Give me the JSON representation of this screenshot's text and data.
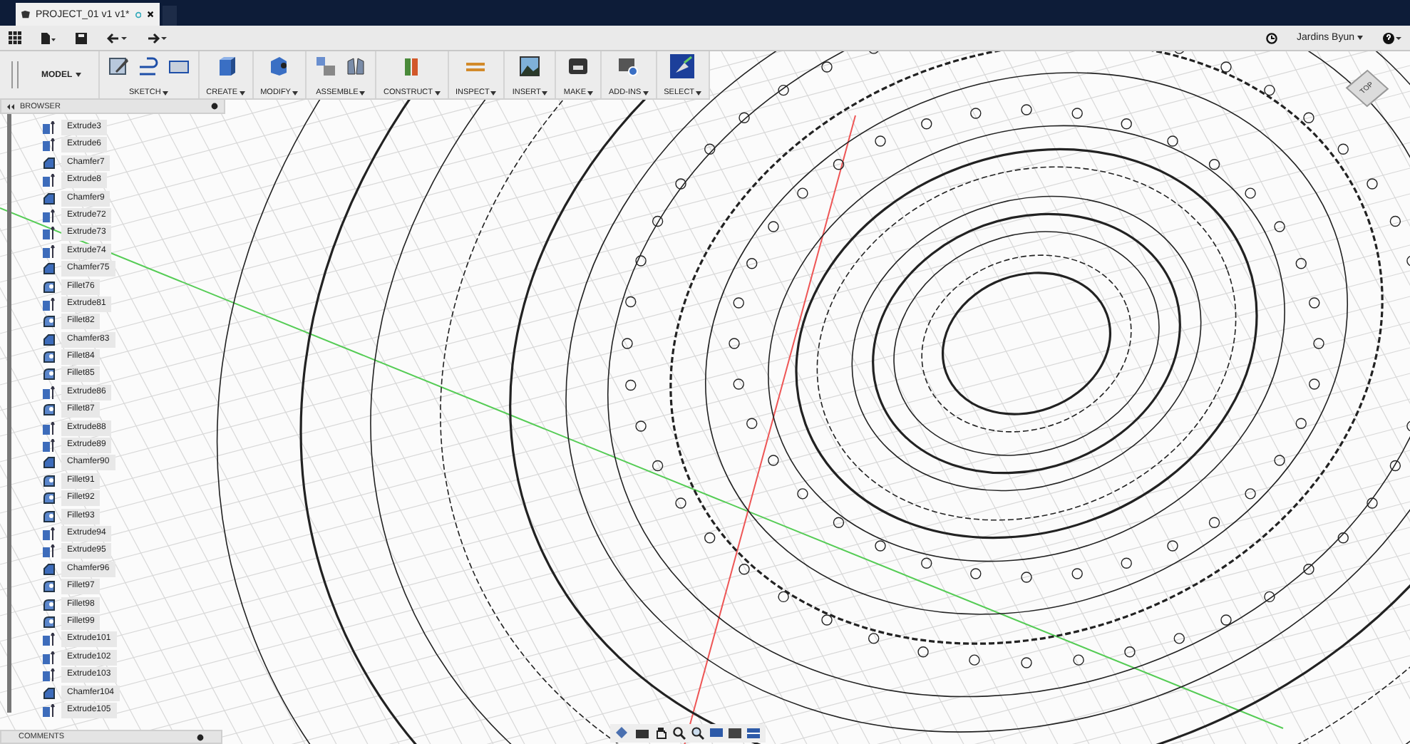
{
  "tab": {
    "title": "PROJECT_01 v1 v1*",
    "unsaved": true
  },
  "user": {
    "name": "Jardins Byun"
  },
  "toolbar": {
    "workspace": "MODEL",
    "groups": [
      {
        "label": "SKETCH",
        "selected": false,
        "tools": [
          {
            "kind": "sketch"
          },
          {
            "kind": "line"
          },
          {
            "kind": "rectangle"
          }
        ]
      },
      {
        "label": "CREATE",
        "selected": false,
        "tools": [
          {
            "kind": "extrude"
          }
        ]
      },
      {
        "label": "MODIFY",
        "selected": false,
        "tools": [
          {
            "kind": "press"
          }
        ]
      },
      {
        "label": "ASSEMBLE",
        "selected": false,
        "tools": [
          {
            "kind": "component"
          },
          {
            "kind": "joint"
          }
        ]
      },
      {
        "label": "CONSTRUCT",
        "selected": false,
        "tools": [
          {
            "kind": "plane"
          }
        ]
      },
      {
        "label": "INSPECT",
        "selected": false,
        "tools": [
          {
            "kind": "measure"
          }
        ]
      },
      {
        "label": "INSERT",
        "selected": false,
        "tools": [
          {
            "kind": "image"
          }
        ]
      },
      {
        "label": "MAKE",
        "selected": false,
        "tools": [
          {
            "kind": "printer"
          }
        ]
      },
      {
        "label": "ADD-INS",
        "selected": false,
        "tools": [
          {
            "kind": "addin"
          }
        ]
      },
      {
        "label": "SELECT",
        "selected": true,
        "tools": [
          {
            "kind": "select"
          }
        ]
      }
    ]
  },
  "browser": {
    "title": "BROWSER",
    "items": [
      {
        "label": "Extrude3",
        "kind": "extrude"
      },
      {
        "label": "Extrude6",
        "kind": "extrude"
      },
      {
        "label": "Chamfer7",
        "kind": "chamfer"
      },
      {
        "label": "Extrude8",
        "kind": "extrude"
      },
      {
        "label": "Chamfer9",
        "kind": "chamfer"
      },
      {
        "label": "Extrude72",
        "kind": "extrude"
      },
      {
        "label": "Extrude73",
        "kind": "extrude"
      },
      {
        "label": "Extrude74",
        "kind": "extrude"
      },
      {
        "label": "Chamfer75",
        "kind": "chamfer"
      },
      {
        "label": "Fillet76",
        "kind": "fillet"
      },
      {
        "label": "Extrude81",
        "kind": "extrude"
      },
      {
        "label": "Fillet82",
        "kind": "fillet"
      },
      {
        "label": "Chamfer83",
        "kind": "chamfer"
      },
      {
        "label": "Fillet84",
        "kind": "fillet"
      },
      {
        "label": "Fillet85",
        "kind": "fillet"
      },
      {
        "label": "Extrude86",
        "kind": "extrude"
      },
      {
        "label": "Fillet87",
        "kind": "fillet"
      },
      {
        "label": "Extrude88",
        "kind": "extrude"
      },
      {
        "label": "Extrude89",
        "kind": "extrude"
      },
      {
        "label": "Chamfer90",
        "kind": "chamfer"
      },
      {
        "label": "Fillet91",
        "kind": "fillet"
      },
      {
        "label": "Fillet92",
        "kind": "fillet"
      },
      {
        "label": "Fillet93",
        "kind": "fillet"
      },
      {
        "label": "Extrude94",
        "kind": "extrude"
      },
      {
        "label": "Extrude95",
        "kind": "extrude"
      },
      {
        "label": "Chamfer96",
        "kind": "chamfer"
      },
      {
        "label": "Fillet97",
        "kind": "fillet"
      },
      {
        "label": "Fillet98",
        "kind": "fillet"
      },
      {
        "label": "Fillet99",
        "kind": "fillet"
      },
      {
        "label": "Extrude101",
        "kind": "extrude"
      },
      {
        "label": "Extrude102",
        "kind": "extrude"
      },
      {
        "label": "Extrude103",
        "kind": "extrude"
      },
      {
        "label": "Chamfer104",
        "kind": "chamfer"
      },
      {
        "label": "Extrude105",
        "kind": "extrude"
      }
    ]
  },
  "view_cube": {
    "face": "TOP"
  },
  "comments": {
    "title": "COMMENTS"
  }
}
